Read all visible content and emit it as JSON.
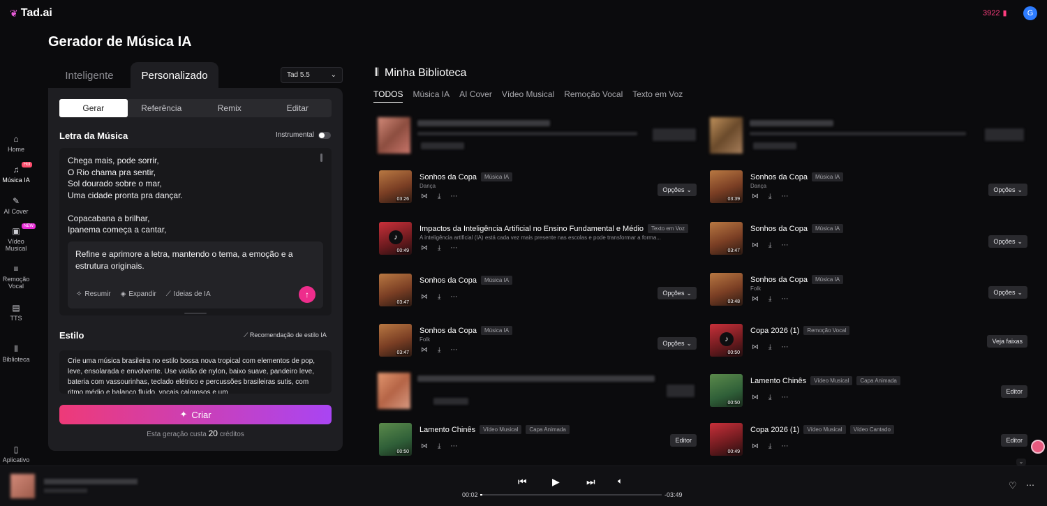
{
  "app": {
    "logo_text": "Tad.ai",
    "credits": "3922",
    "user_initial": "G"
  },
  "sidebar": [
    {
      "label": "Home",
      "icon": "home-icon"
    },
    {
      "label": "Música IA",
      "icon": "music-icon",
      "badge": "Hot"
    },
    {
      "label": "AI Cover",
      "icon": "mic-icon"
    },
    {
      "label": "Vídeo Musical",
      "icon": "video-icon",
      "badge": "NEW"
    },
    {
      "label": "Remoção Vocal",
      "icon": "vocal-remove-icon"
    },
    {
      "label": "TTS",
      "icon": "tts-icon"
    },
    {
      "label": "Biblioteca",
      "icon": "library-icon"
    },
    {
      "label": "Aplicativo",
      "icon": "phone-icon"
    }
  ],
  "generator": {
    "title": "Gerador de Música IA",
    "mode_tabs": [
      "Inteligente",
      "Personalizado"
    ],
    "active_mode": "Personalizado",
    "version": "Tad 5.5",
    "seg_tabs": [
      "Gerar",
      "Referência",
      "Remix",
      "Editar"
    ],
    "lyrics_label": "Letra da Música",
    "instrumental_label": "Instrumental",
    "lyrics": "Chega mais, pode sorrir,\nO Rio chama pra sentir,\nSol dourado sobre o mar,\nUma cidade pronta pra dançar.\n\nCopacabana a brilhar,\nIpanema começa a cantar,",
    "refine_text": "Refine e aprimore a letra, mantendo o tema, a emoção e a estrutura originais.",
    "chips": [
      "Resumir",
      "Expandir",
      "Ideias de IA"
    ],
    "style_label": "Estilo",
    "style_rec": "Recomendação de estilo IA",
    "style_text": "Crie uma música brasileira no estilo bossa nova tropical com elementos de pop, leve, ensolarada e envolvente. Use violão de nylon, baixo suave, pandeiro leve, bateria com vassourinhas, teclado elétrico e percussões brasileiras sutis, com ritmo médio e balanço fluido, vocais calorosos e um",
    "create_label": "Criar",
    "cost_prefix": "Esta geração custa",
    "cost_value": "20",
    "cost_suffix": "créditos"
  },
  "library": {
    "title": "Minha Biblioteca",
    "tabs": [
      "TODOS",
      "Música IA",
      "AI Cover",
      "Vídeo Musical",
      "Remoção Vocal",
      "Texto em Voz"
    ],
    "active_tab": "TODOS",
    "left": [
      {
        "title": "Sonhos da Copa",
        "badges": [
          "Música IA"
        ],
        "sub": "Dança",
        "dur": "03:26",
        "button": "Opções",
        "thumb": "warm"
      },
      {
        "title": "Impactos da Inteligência Artificial no Ensino Fundamental e Médio",
        "badges": [
          "Texto em Voz"
        ],
        "sub": "A inteligência artificial (IA) está cada vez mais presente nas escolas e pode transformar a forma...",
        "dur": "00:49",
        "button": "",
        "thumb": "red-note"
      },
      {
        "title": "Sonhos da Copa",
        "badges": [
          "Música IA"
        ],
        "sub": "",
        "dur": "03:47",
        "button": "Opções",
        "thumb": "warm"
      },
      {
        "title": "Sonhos da Copa",
        "badges": [
          "Música IA"
        ],
        "sub": "Folk",
        "dur": "03:47",
        "button": "Opções",
        "thumb": "warm"
      },
      {
        "title": "Lamento Chinês",
        "badges": [
          "Vídeo Musical",
          "Capa Animada"
        ],
        "sub": "",
        "dur": "00:50",
        "button": "Editor",
        "thumb": "green"
      }
    ],
    "right": [
      {
        "title": "Sonhos da Copa",
        "badges": [
          "Música IA"
        ],
        "sub": "Dança",
        "dur": "03:39",
        "button": "Opções",
        "thumb": "warm"
      },
      {
        "title": "Sonhos da Copa",
        "badges": [
          "Música IA"
        ],
        "sub": "",
        "dur": "03:47",
        "button": "Opções",
        "thumb": "warm"
      },
      {
        "title": "Sonhos da Copa",
        "badges": [
          "Música IA"
        ],
        "sub": "Folk",
        "dur": "03:48",
        "button": "Opções",
        "thumb": "warm"
      },
      {
        "title": "Copa 2026 (1)",
        "badges": [
          "Remoção Vocal"
        ],
        "sub": "",
        "dur": "00:50",
        "button": "Veja faixas",
        "thumb": "red-note"
      },
      {
        "title": "Lamento Chinês",
        "badges": [
          "Vídeo Musical",
          "Capa Animada"
        ],
        "sub": "",
        "dur": "00:50",
        "button": "Editor",
        "thumb": "green"
      },
      {
        "title": "Copa 2026 (1)",
        "badges": [
          "Vídeo Musical",
          "Vídeo Cantado"
        ],
        "sub": "",
        "dur": "00:49",
        "button": "Editor",
        "thumb": "red"
      }
    ]
  },
  "player": {
    "current": "00:02",
    "remaining": "-03:49",
    "progress": 0.01
  }
}
